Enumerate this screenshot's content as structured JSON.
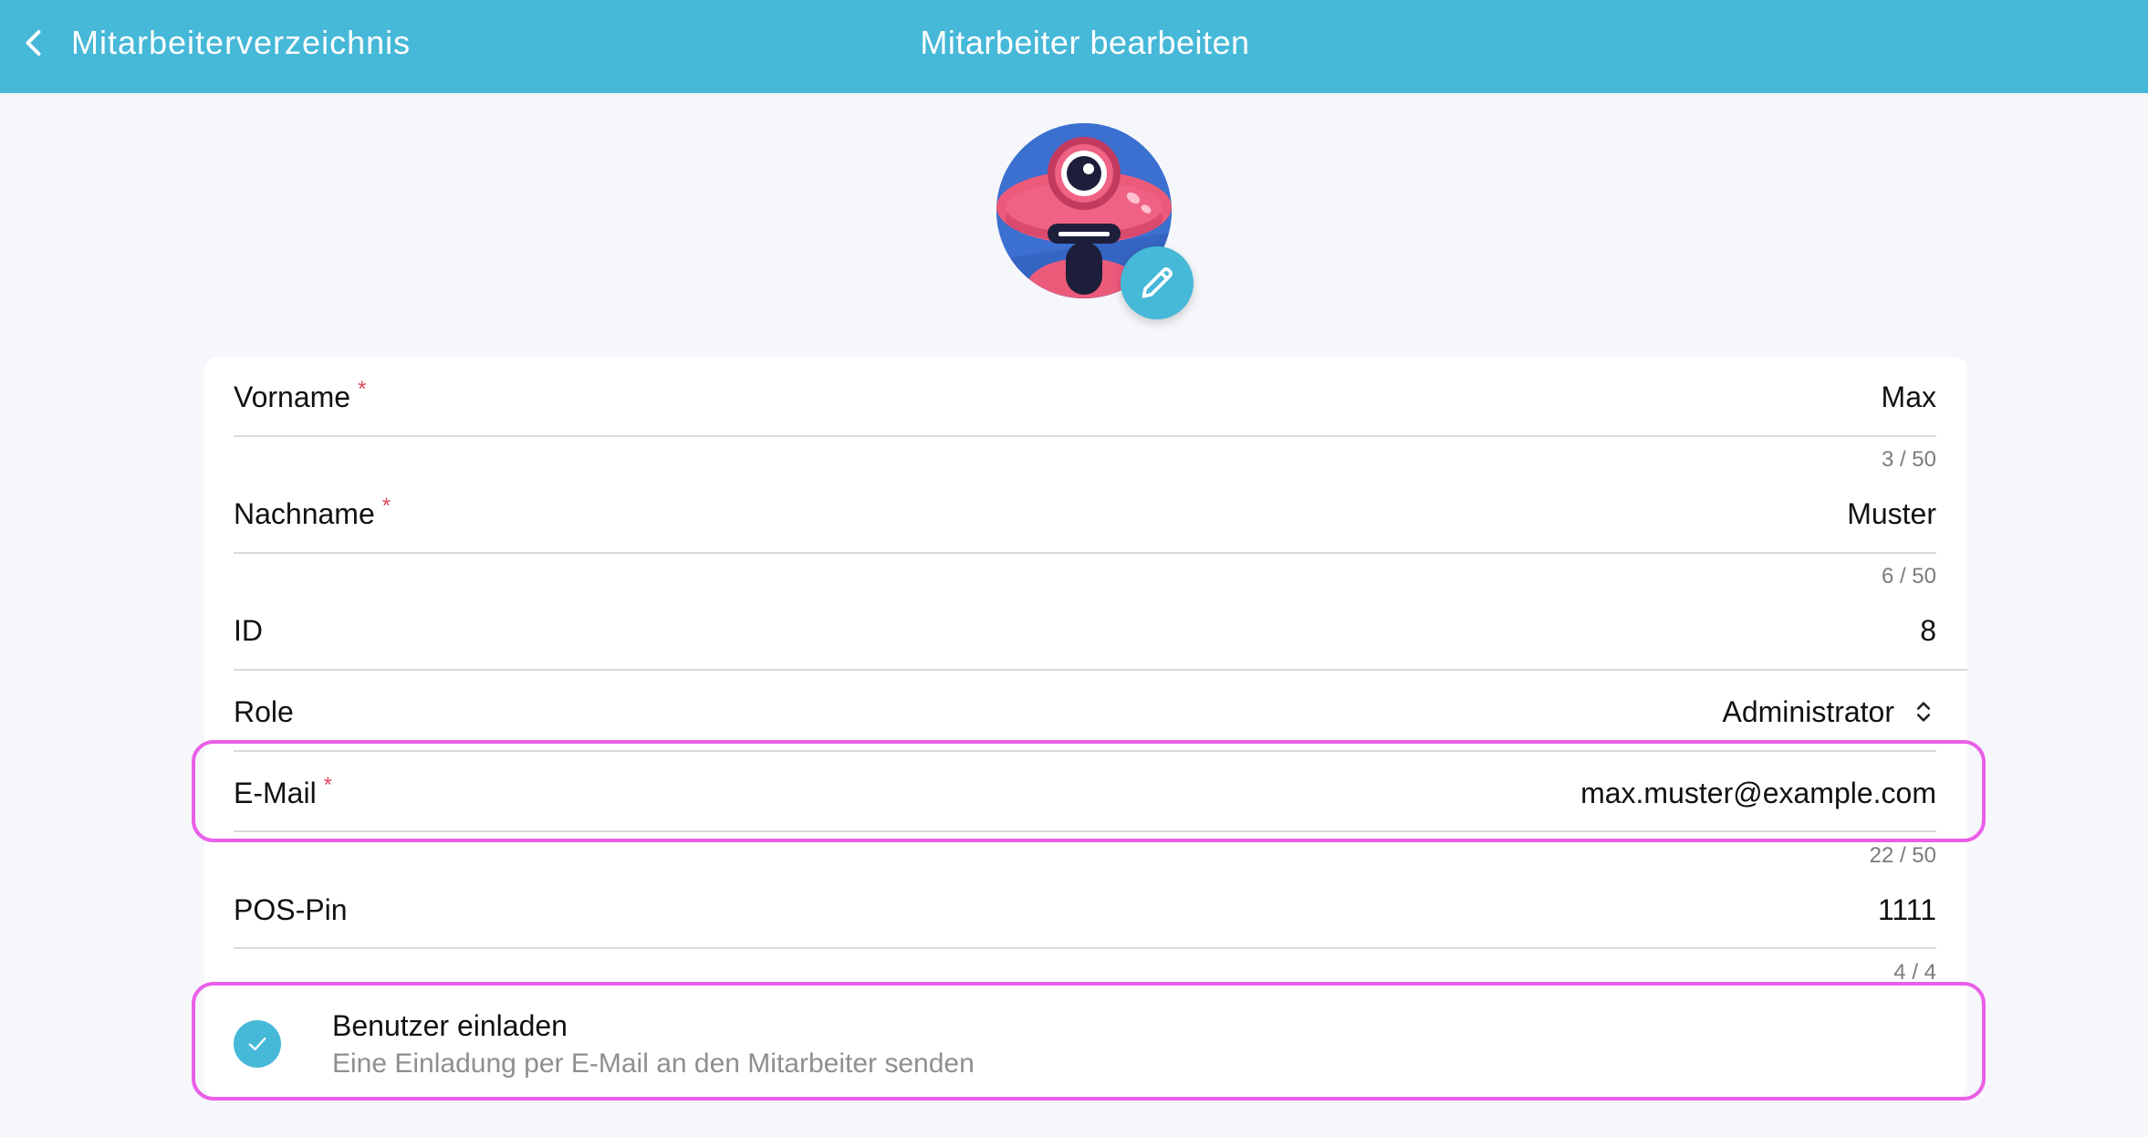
{
  "header": {
    "back_label": "Mitarbeiterverzeichnis",
    "title": "Mitarbeiter bearbeiten"
  },
  "avatar": {
    "image": "robot-avatar",
    "edit_icon": "pencil-icon"
  },
  "form": {
    "first_name": {
      "label": "Vorname",
      "required": "*",
      "value": "Max",
      "counter": "3 / 50"
    },
    "last_name": {
      "label": "Nachname",
      "required": "*",
      "value": "Muster",
      "counter": "6 / 50"
    },
    "id": {
      "label": "ID",
      "value": "8"
    },
    "role": {
      "label": "Role",
      "value": "Administrator",
      "icon": "chevron-up-down-icon"
    },
    "email": {
      "label": "E-Mail",
      "required": "*",
      "value": "max.muster@example.com",
      "counter": "22 / 50"
    },
    "pos_pin": {
      "label": "POS-Pin",
      "value": "1111",
      "counter": "4 / 4"
    }
  },
  "invite": {
    "title": "Benutzer einladen",
    "subtitle": "Eine Einladung per E-Mail an den Mitarbeiter senden",
    "checked": true
  },
  "colors": {
    "header": "#46b8d8",
    "accent": "#46b8d8",
    "required": "#e04a5a",
    "highlight": "#ea5fe8"
  }
}
